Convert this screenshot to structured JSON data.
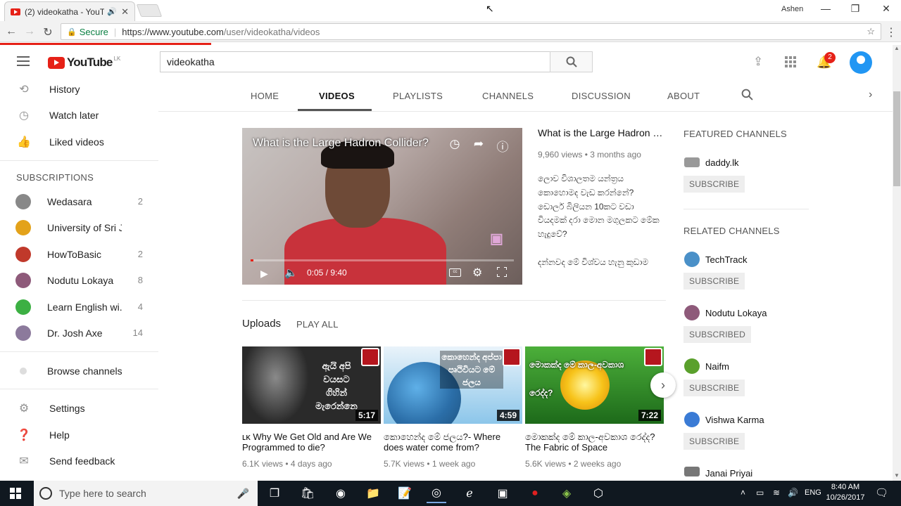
{
  "browser": {
    "tab_title": "(2) videokatha - YouTu",
    "tab_close": "✕",
    "user": "Ashen",
    "secure_label": "Secure",
    "url_prefix": "https://www.youtube.com",
    "url_path": "/user/videokatha/videos",
    "window_buttons": [
      "—",
      "❐",
      "✕"
    ]
  },
  "masthead": {
    "logo_text": "YouTube",
    "country": "LK",
    "search_value": "videokatha",
    "notification_count": "2"
  },
  "sidebar": {
    "top_items": [
      {
        "icon": "history-icon",
        "label": "History"
      },
      {
        "icon": "watch-later-icon",
        "label": "Watch later"
      },
      {
        "icon": "thumbs-up-icon",
        "label": "Liked videos"
      }
    ],
    "subscriptions_heading": "SUBSCRIPTIONS",
    "subscriptions": [
      {
        "name": "Wedasara",
        "count": "2",
        "color": "#888888"
      },
      {
        "name": "University of Sri J...",
        "count": "",
        "color": "#e3a21a"
      },
      {
        "name": "HowToBasic",
        "count": "2",
        "color": "#c0392b"
      },
      {
        "name": "Nodutu Lokaya",
        "count": "8",
        "color": "#8e5a7a"
      },
      {
        "name": "Learn English wi...",
        "count": "4",
        "color": "#3cb043"
      },
      {
        "name": "Dr. Josh Axe",
        "count": "14",
        "color": "#8c7a9c"
      }
    ],
    "browse_channels": "Browse channels",
    "bottom_items": [
      {
        "icon": "settings-icon",
        "label": "Settings"
      },
      {
        "icon": "help-icon",
        "label": "Help"
      },
      {
        "icon": "feedback-icon",
        "label": "Send feedback"
      }
    ]
  },
  "channel_tabs": [
    "HOME",
    "VIDEOS",
    "PLAYLISTS",
    "CHANNELS",
    "DISCUSSION",
    "ABOUT"
  ],
  "active_tab": "VIDEOS",
  "featured_video": {
    "overlay_title": "What is the Large Hadron Collider?",
    "time": "0:05 / 9:40",
    "progress_fraction": 0.009,
    "title": "What is the Large Hadron Col...",
    "meta": "9,960 views • 3 months ago",
    "description_lines": [
      "ලොව විශාලතම යන්ත්‍රය",
      "කොහොමද වැඩ කරන්නේ?",
      "ඩොලර් බිලියන 10කට වඩා",
      "වියදමක් දරා මොන මගුලකට මේක",
      "හැදුවේ?",
      "",
      "දන්නවද මේ විශ්වය හැනු කුඩාම"
    ]
  },
  "uploads": {
    "heading": "Uploads",
    "play_all": "PLAY ALL",
    "videos": [
      {
        "thumb_text": "ඇයි අපි වයසට ගිහින් මැරෙන්නෙ",
        "duration": "5:17",
        "title": "ʟᴋ Why We Get Old and Are We Programmed to die?",
        "meta": "6.1K views • 4 days ago",
        "bg": "#2a2a2a"
      },
      {
        "thumb_text": "කොහෙන්ද අප්පා පෘථිවියට මේ ජලය",
        "duration": "4:59",
        "title": "කොහෙන්ද මේ ජලය?- Where does water come from?",
        "meta": "5.7K views • 1 week ago",
        "bg": "#6fb6e0"
      },
      {
        "thumb_text": "මොකක්ද මේ කාල-අවකාශ රෙද්ද?",
        "duration": "7:22",
        "title": "මොකක්ද මේ කාල-අවකාශ රෙද්ද? The Fabric of Space",
        "meta": "5.6K views • 2 weeks ago",
        "bg": "#2f8a2a"
      }
    ]
  },
  "right_column": {
    "featured_heading": "FEATURED CHANNELS",
    "featured": [
      {
        "name": "daddy.lk",
        "button": "SUBSCRIBE",
        "color": "#999999"
      }
    ],
    "related_heading": "RELATED CHANNELS",
    "related": [
      {
        "name": "TechTrack",
        "button": "SUBSCRIBE",
        "color": "#4a90c8"
      },
      {
        "name": "Nodutu Lokaya",
        "button": "SUBSCRIBED",
        "color": "#8e5a7a"
      },
      {
        "name": "Naifm",
        "button": "SUBSCRIBE",
        "color": "#5aa02c"
      },
      {
        "name": "Vishwa Karma",
        "button": "SUBSCRIBE",
        "color": "#3a7bd5"
      },
      {
        "name": "Janai Priyai",
        "button": "",
        "color": "#777777"
      }
    ]
  },
  "taskbar": {
    "search_placeholder": "Type here to search",
    "lang": "ENG",
    "time": "8:40 AM",
    "date": "10/26/2017"
  },
  "colors": {
    "brand_red": "#e62117",
    "taskbar": "#101820"
  }
}
